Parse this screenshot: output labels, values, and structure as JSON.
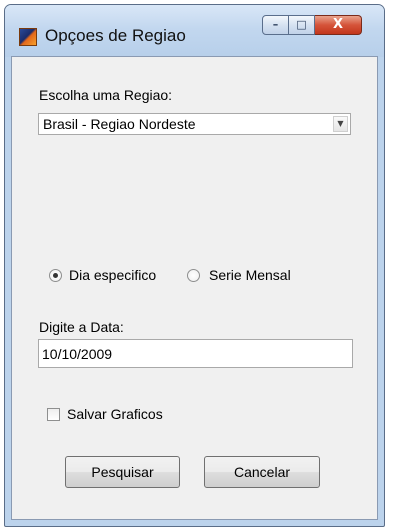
{
  "window": {
    "title": "Opçoes de Regiao",
    "icon": "matlab-icon",
    "caption_buttons": {
      "minimize": "–",
      "maximize": "□",
      "close": "X"
    }
  },
  "region": {
    "label": "Escolha uma Regiao:",
    "selected": "Brasil - Regiao Nordeste",
    "arrow": "▼"
  },
  "mode": {
    "options": [
      {
        "label": "Dia especifico",
        "checked": true
      },
      {
        "label": "Serie Mensal",
        "checked": false
      }
    ]
  },
  "date": {
    "label": "Digite a Data:",
    "value": "10/10/2009"
  },
  "save": {
    "label": "Salvar Graficos",
    "checked": false
  },
  "buttons": {
    "search": "Pesquisar",
    "cancel": "Cancelar"
  }
}
